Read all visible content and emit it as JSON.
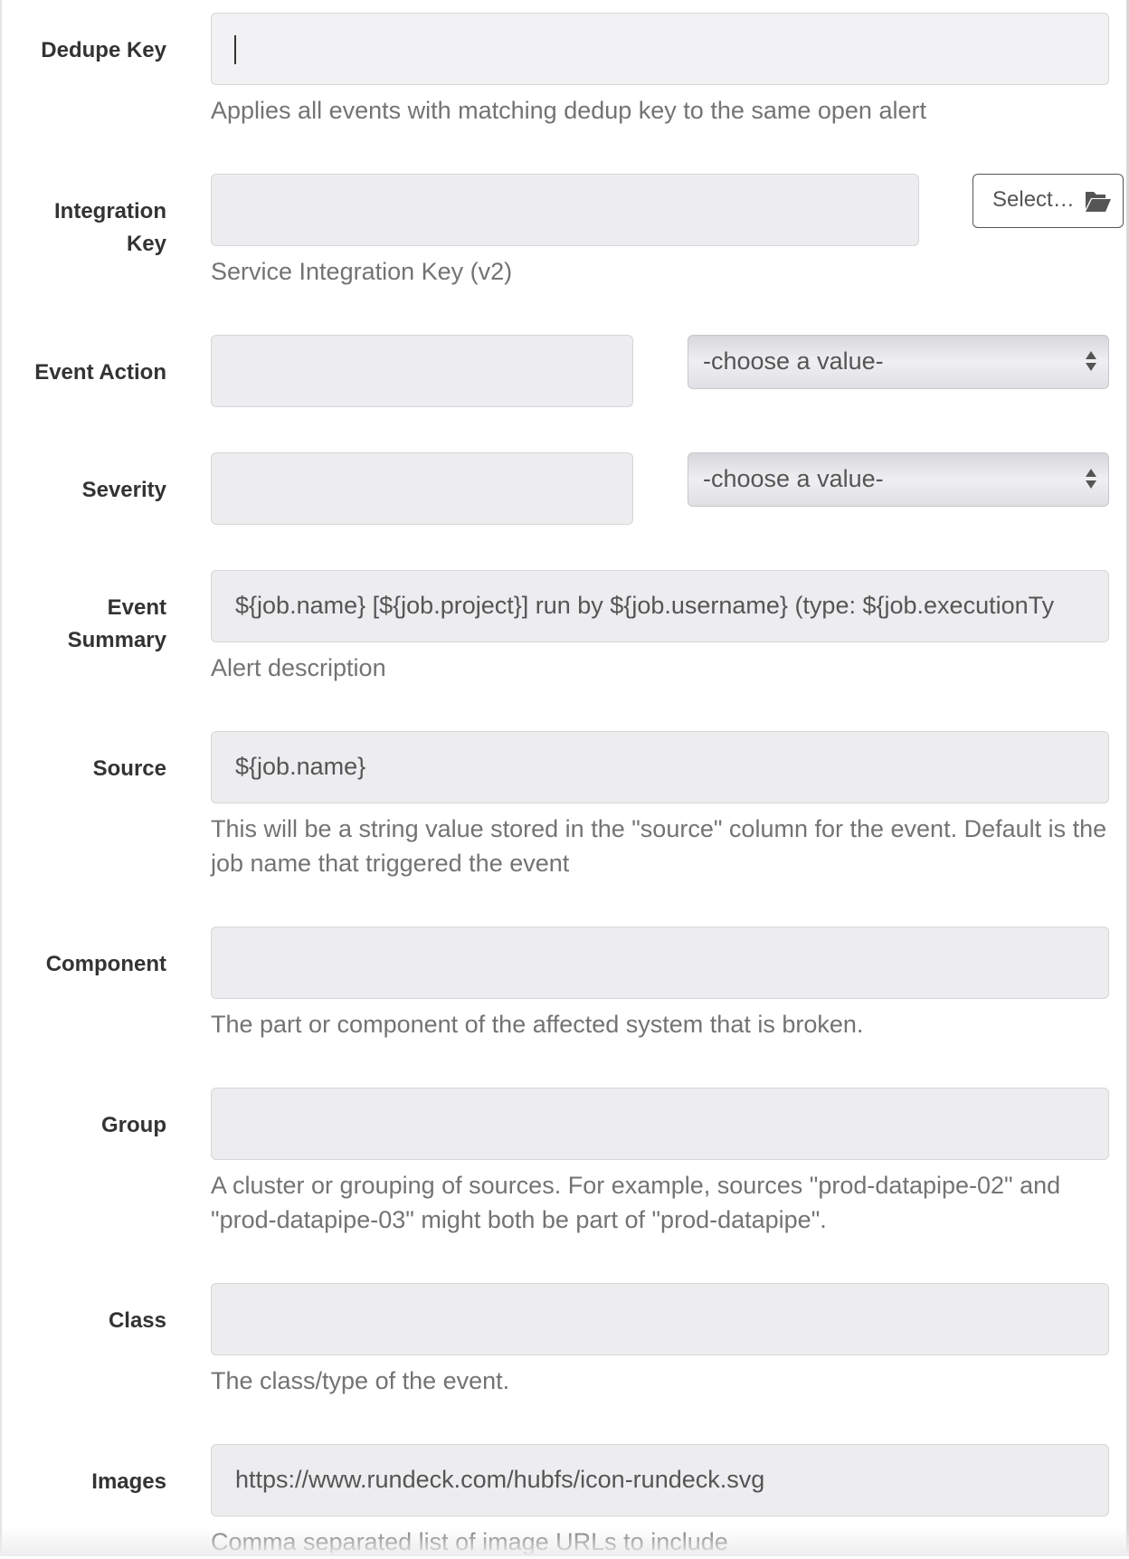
{
  "fields": {
    "dedupe_key": {
      "label": "Dedupe Key",
      "value": "",
      "help": "Applies all events with matching dedup key to the same open alert"
    },
    "integration_key": {
      "label": "Integration\nKey",
      "value": "",
      "help": "Service Integration Key (v2)",
      "select_button_label": "Select…",
      "select_button_icon": "folder-open-icon"
    },
    "event_action": {
      "label": "Event Action",
      "value": "",
      "select_value": "-choose a value-"
    },
    "severity": {
      "label": "Severity",
      "value": "",
      "select_value": "-choose a value-"
    },
    "event_summary": {
      "label": "Event\nSummary",
      "value": "${job.name} [${job.project}] run by ${job.username} (type: ${job.executionTy",
      "help": "Alert description"
    },
    "source": {
      "label": "Source",
      "value": "${job.name}",
      "help": "This will be a string value stored in the \"source\" column for the event. Default is the job name that triggered the event"
    },
    "component": {
      "label": "Component",
      "value": "",
      "help": "The part or component of the affected system that is broken."
    },
    "group": {
      "label": "Group",
      "value": "",
      "help": "A cluster or grouping of sources. For example, sources \"prod-datapipe-02\" and \"prod-datapipe-03\" might both be part of \"prod-datapipe\"."
    },
    "class": {
      "label": "Class",
      "value": "",
      "help": "The class/type of the event."
    },
    "images": {
      "label": "Images",
      "value": "https://www.rundeck.com/hubfs/icon-rundeck.svg",
      "help": "Comma separated list of image URLs to include"
    }
  },
  "colors": {
    "input_background": "#ededf0",
    "label_text": "#333333",
    "help_text": "#737373"
  }
}
